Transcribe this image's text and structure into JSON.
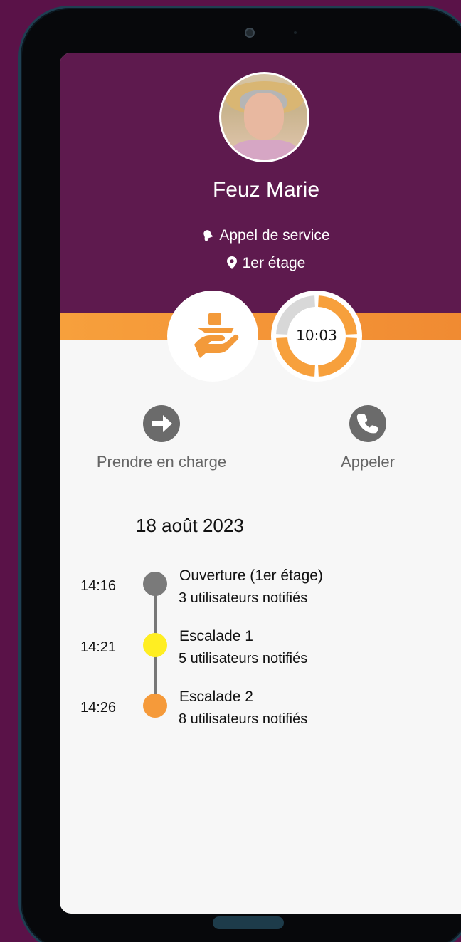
{
  "person": {
    "name": "Feuz Marie"
  },
  "call": {
    "type": "Appel de service",
    "location": "1er étage",
    "timer": "10:03",
    "timer_progress": 0.75
  },
  "actions": {
    "take_charge": "Prendre en charge",
    "call": "Appeler"
  },
  "history": {
    "date": "18 août 2023",
    "events": [
      {
        "time": "14:16",
        "title": "Ouverture (1er étage)",
        "detail": "3 utilisateurs notifiés",
        "color": "#7a7a7a"
      },
      {
        "time": "14:21",
        "title": "Escalade 1",
        "detail": "5 utilisateurs notifiés",
        "color": "#ffee22"
      },
      {
        "time": "14:26",
        "title": "Escalade 2",
        "detail": "8 utilisateurs notifiés",
        "color": "#f59a3a"
      }
    ]
  },
  "colors": {
    "header": "#5e1a4e",
    "accent": "#f7a03c",
    "background": "#5a1248"
  }
}
